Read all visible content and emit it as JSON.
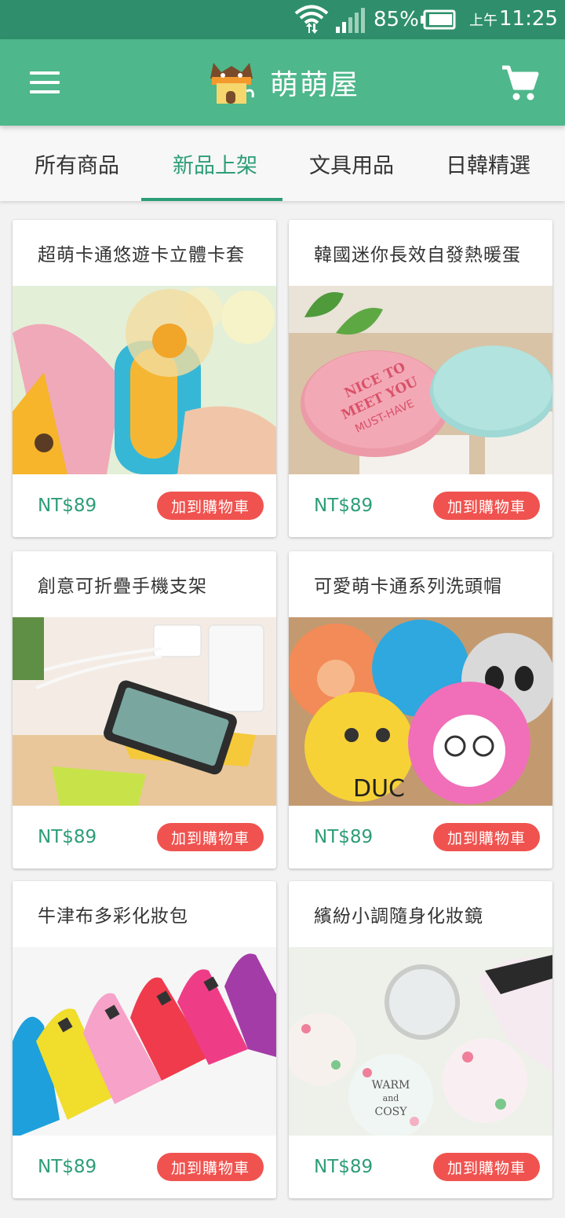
{
  "status_bar": {
    "battery": "85%",
    "ampm": "上午",
    "time": "11:25"
  },
  "app_bar": {
    "title": "萌萌屋",
    "menu_icon": "menu-icon",
    "cart_icon": "shopping-cart-icon",
    "color": "#4eb78b"
  },
  "tabs": [
    {
      "label": "所有商品",
      "active": false
    },
    {
      "label": "新品上架",
      "active": true
    },
    {
      "label": "文具用品",
      "active": false
    },
    {
      "label": "日韓精選",
      "active": false
    }
  ],
  "products": [
    {
      "name": "超萌卡通悠遊卡立體卡套",
      "price": "NT$89",
      "button": "加到購物車",
      "image": "mini-fan-photo"
    },
    {
      "name": "韓國迷你長效自發熱暖蛋",
      "price": "NT$89",
      "button": "加到購物車",
      "image": "hand-warmer-photo"
    },
    {
      "name": "創意可折疊手機支架",
      "price": "NT$89",
      "button": "加到購物車",
      "image": "phone-holder-photo"
    },
    {
      "name": "可愛萌卡通系列洗頭帽",
      "price": "NT$89",
      "button": "加到購物車",
      "image": "shower-caps-photo"
    },
    {
      "name": "牛津布多彩化妝包",
      "price": "NT$89",
      "button": "加到購物車",
      "image": "cosmetic-bags-photo"
    },
    {
      "name": "繽紛小調隨身化妝鏡",
      "price": "NT$89",
      "button": "加到購物車",
      "image": "pocket-mirrors-photo"
    }
  ],
  "image_texts": {
    "warmer": [
      "NICE TO",
      "MEET YOU",
      "MUST-HAVE"
    ],
    "duck": "DUC",
    "mirror": [
      "WARM",
      "and",
      "COSY"
    ]
  },
  "colors": {
    "accent": "#2d9d78",
    "status_bar": "#2f8f6c",
    "button": "#f0534f"
  }
}
